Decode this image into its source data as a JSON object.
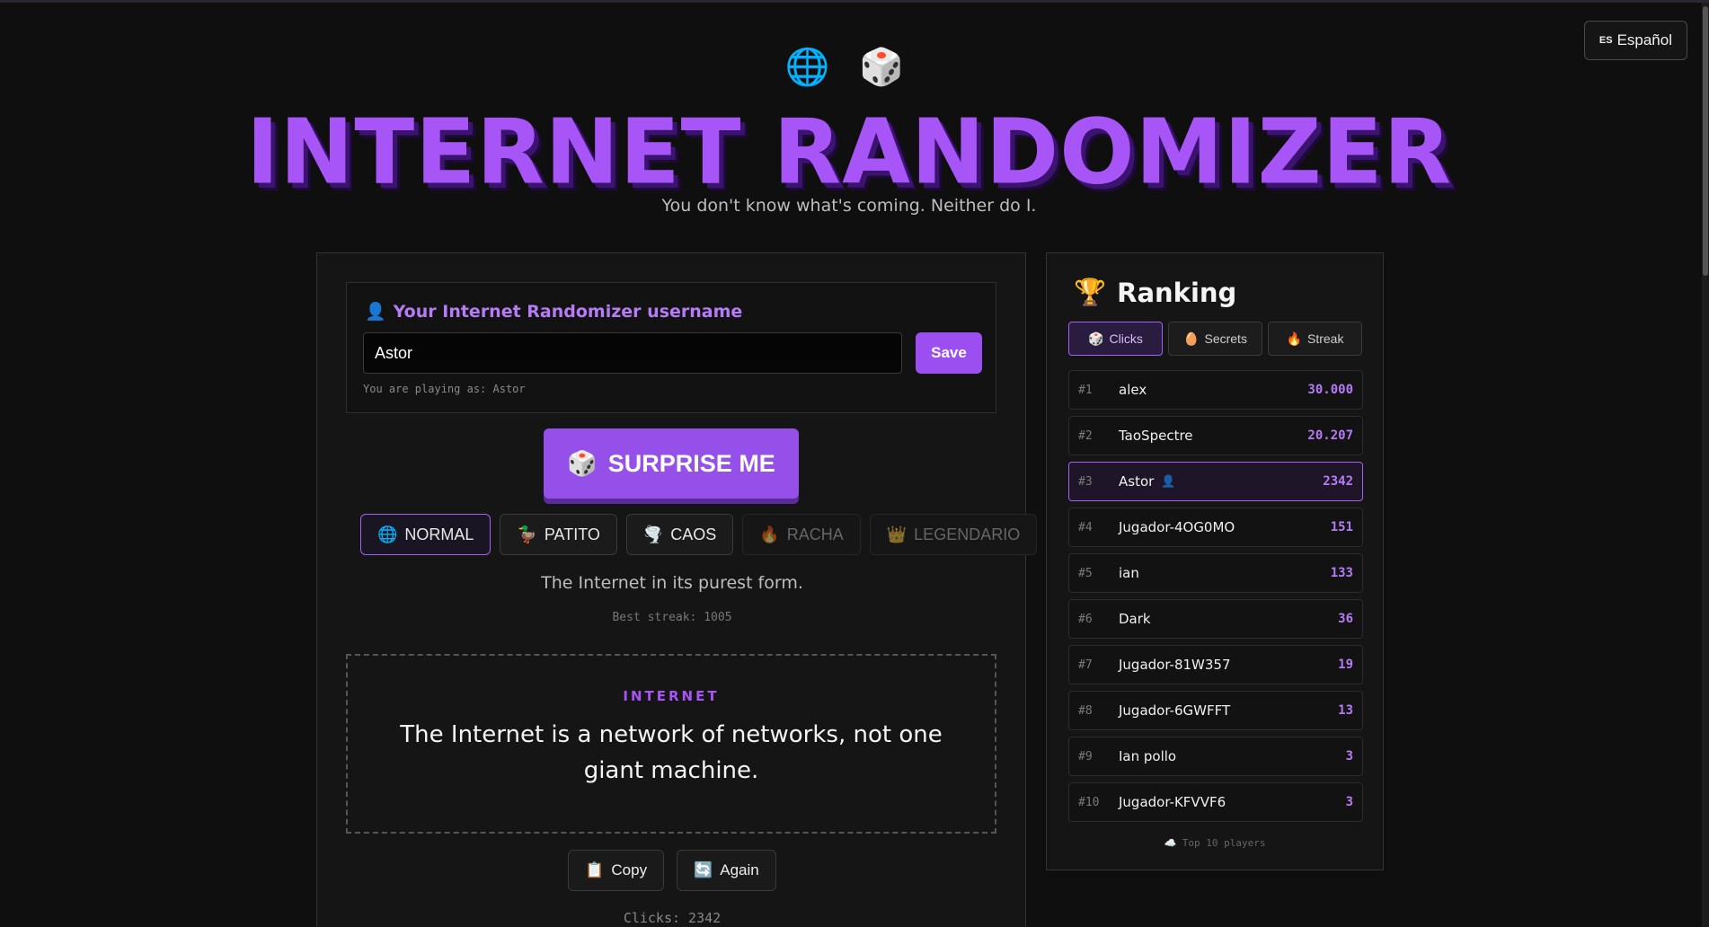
{
  "language_button": {
    "flag": "ES",
    "label": "Español"
  },
  "hero": {
    "icons": "🌐 🎲",
    "title": "INTERNET RANDOMIZER",
    "subtitle": "You don't know what's coming. Neither do I."
  },
  "user": {
    "icon": "👤",
    "label": "Your Internet Randomizer username",
    "value": "Astor",
    "save_label": "Save",
    "playing_as": "You are playing as: Astor"
  },
  "surprise": {
    "icon": "🎲",
    "label": "SURPRISE ME"
  },
  "modes": [
    {
      "icon": "🌐",
      "label": "NORMAL",
      "state": "active"
    },
    {
      "icon": "🦆",
      "label": "PATITO",
      "state": "normal"
    },
    {
      "icon": "🌪️",
      "label": "CAOS",
      "state": "normal"
    },
    {
      "icon": "🔥",
      "label": "RACHA",
      "state": "locked"
    },
    {
      "icon": "👑",
      "label": "LEGENDARIO",
      "state": "locked"
    }
  ],
  "mode_description": "The Internet in its purest form.",
  "best_streak": "Best streak: 1005",
  "fact": {
    "category": "INTERNET",
    "text": "The Internet is a network of networks, not one giant machine."
  },
  "actions": {
    "copy_icon": "📋",
    "copy_label": "Copy",
    "again_icon": "🔄",
    "again_label": "Again"
  },
  "clicks": "Clicks: 2342",
  "ranking": {
    "icon": "🏆",
    "title": "Ranking",
    "tabs": [
      {
        "icon": "🎲",
        "label": "Clicks"
      },
      {
        "icon": "🥚",
        "label": "Secrets"
      },
      {
        "icon": "🔥",
        "label": "Streak"
      }
    ],
    "rows": [
      {
        "pos": "#1",
        "name": "alex",
        "score": "30.000"
      },
      {
        "pos": "#2",
        "name": "TaoSpectre",
        "score": "20.207"
      },
      {
        "pos": "#3",
        "name": "Astor",
        "score": "2342",
        "me_icon": "👤"
      },
      {
        "pos": "#4",
        "name": "Jugador-4OG0MO",
        "score": "151"
      },
      {
        "pos": "#5",
        "name": "ian",
        "score": "133"
      },
      {
        "pos": "#6",
        "name": "Dark",
        "score": "36"
      },
      {
        "pos": "#7",
        "name": "Jugador-81W357",
        "score": "19"
      },
      {
        "pos": "#8",
        "name": "Jugador-6GWFFT",
        "score": "13"
      },
      {
        "pos": "#9",
        "name": "Ian pollo",
        "score": "3"
      },
      {
        "pos": "#10",
        "name": "Jugador-KFVVF6",
        "score": "3"
      }
    ],
    "footer_icon": "☁️",
    "footer": "Top 10 players"
  },
  "colors": {
    "accent": "#a855f7",
    "background": "#0f0f0f",
    "panel": "#151515"
  }
}
